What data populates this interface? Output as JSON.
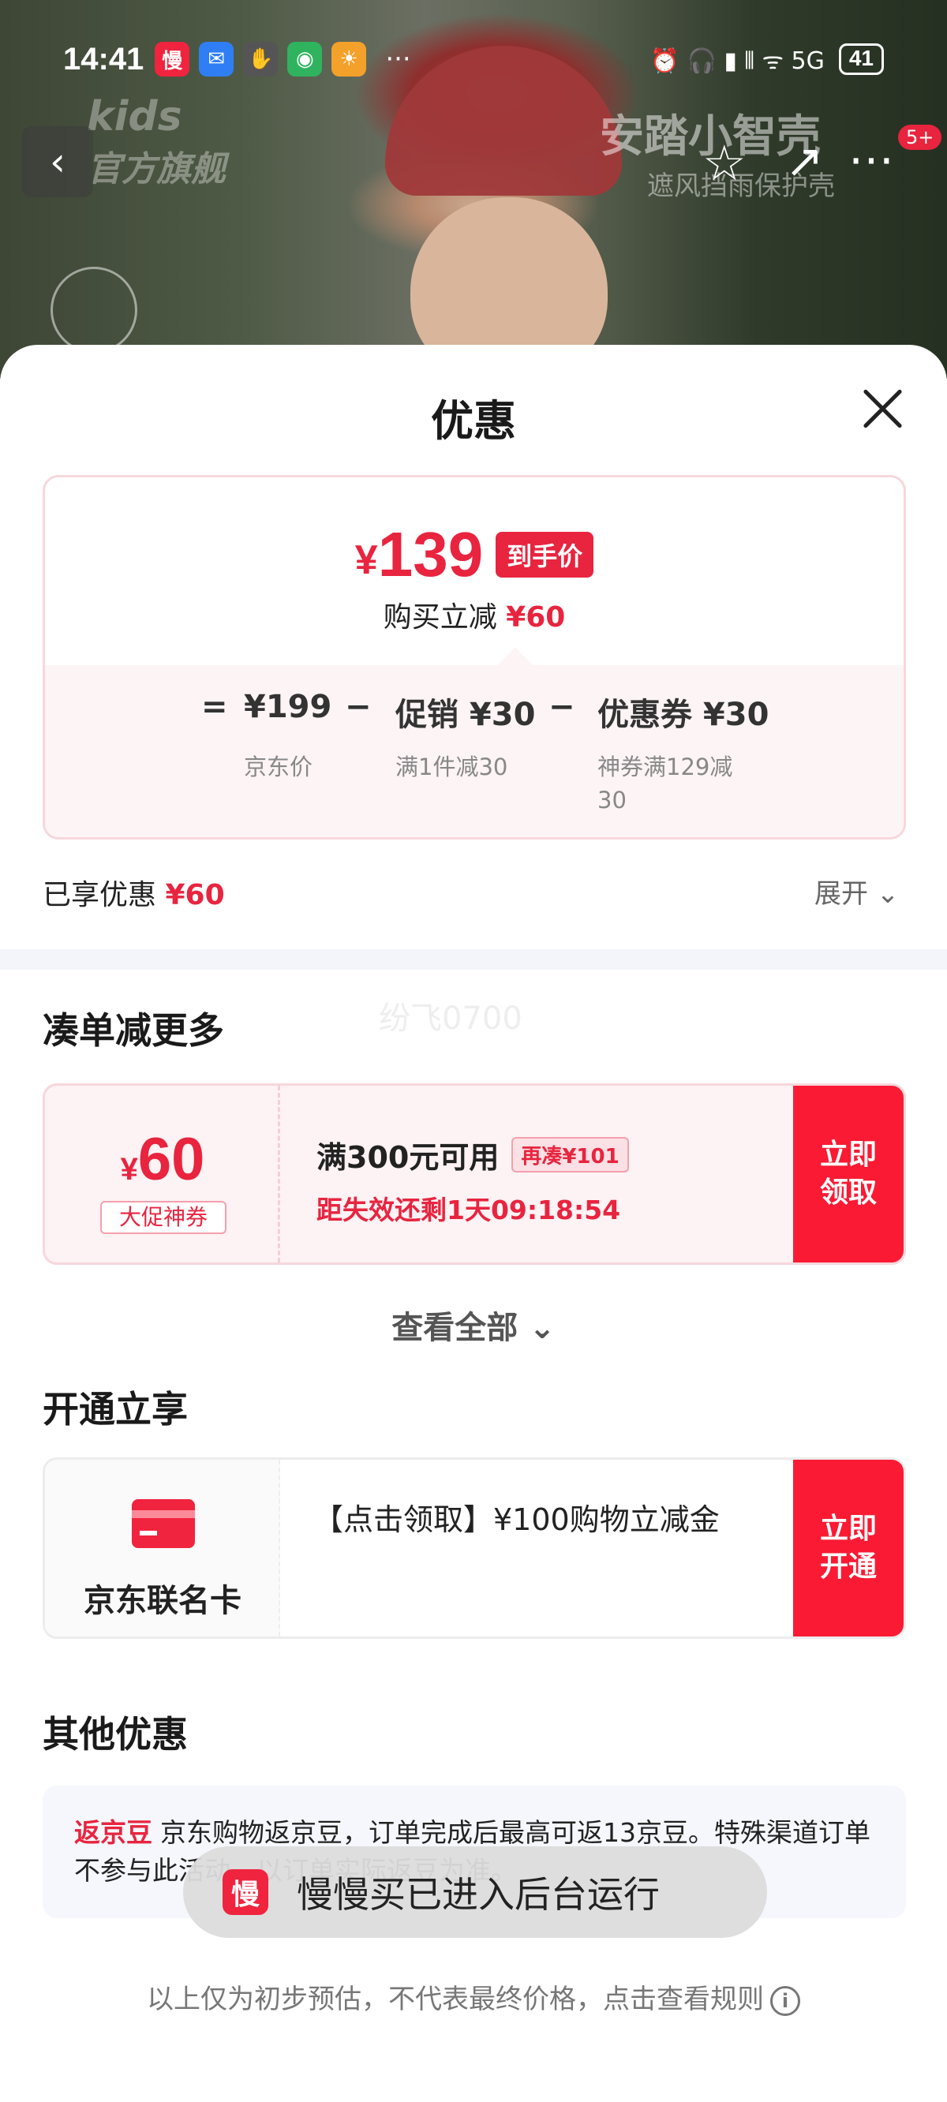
{
  "status_bar": {
    "time": "14:41",
    "apps": [
      {
        "name": "manman-app-icon",
        "glyph": "慢",
        "color": "#f0243e"
      },
      {
        "name": "messages-app-icon",
        "glyph": "✉",
        "color": "#2f7ef5"
      },
      {
        "name": "gesture-app-icon",
        "glyph": "✋",
        "color": "#555555"
      },
      {
        "name": "mobile-app-icon",
        "glyph": "◉",
        "color": "#2fb35f"
      },
      {
        "name": "weather-app-icon",
        "glyph": "☀",
        "color": "#f3a12a"
      }
    ],
    "more": "···",
    "right_icons": "⏰ 🎧 ▮ ⫴ ᯤ 5G",
    "battery": "41"
  },
  "background": {
    "brand_left": "kids",
    "brand_left_sub": "官方旗舰",
    "brand_right": "安踏小智壳",
    "brand_right_sub": "遮风挡雨保护壳",
    "badge": "5+"
  },
  "sheet": {
    "title": "优惠"
  },
  "price_card": {
    "yen": "¥",
    "final_price": "139",
    "tag": "到手价",
    "reduce_label": "购买立减",
    "reduce_value": "¥60",
    "eq": "=",
    "jd_price": "¥199",
    "jd_price_label": "京东价",
    "minus1": "−",
    "promo": "促销 ¥30",
    "promo_label": "满1件减30",
    "minus2": "−",
    "coupon": "优惠券 ¥30",
    "coupon_label": "神券满129减30"
  },
  "summary": {
    "enjoyed_label": "已享优惠",
    "enjoyed_value": "¥60",
    "expand": "展开 ⌄"
  },
  "section_more": {
    "title": "凑单减更多",
    "watermark": "纷飞0700",
    "coupon": {
      "yen": "¥",
      "amount": "60",
      "badge": "大促神券",
      "condition": "满300元可用",
      "extra": "再凑¥101",
      "expire": "距失效还剩1天09:18:54",
      "button": "立即领取"
    },
    "view_all": "查看全部 ⌄"
  },
  "section_open": {
    "title": "开通立享",
    "card_name": "京东联名卡",
    "desc": "【点击领取】¥100购物立减金",
    "button": "立即开通"
  },
  "section_other": {
    "title": "其他优惠",
    "tag": "返京豆",
    "text": "京东购物返京豆，订单完成后最高可返13京豆。特殊渠道订单不参与此活动，以订单实际返豆为准。"
  },
  "toast": {
    "icon": "慢",
    "text": "慢慢买已进入后台运行"
  },
  "footer": {
    "note": "以上仅为初步预估，不代表最终价格，点击查看规则",
    "info": "i"
  }
}
